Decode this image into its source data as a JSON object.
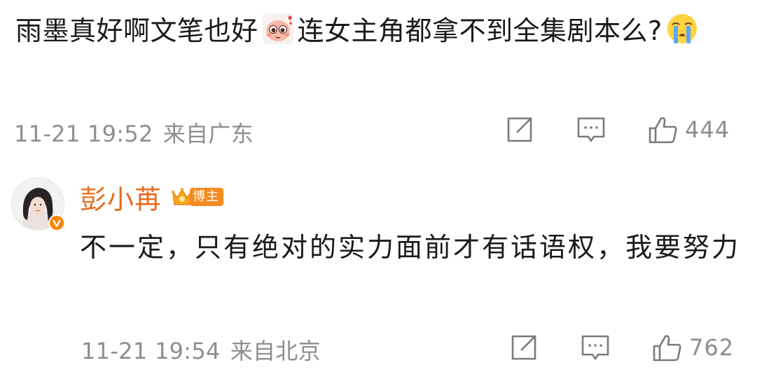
{
  "comment": {
    "text_part1": "雨墨真好啊文笔也好",
    "emoji1": "shy-blush-emoji",
    "text_part2": "连女主角都拿不到全集剧本么?",
    "emoji2": "crying-face-emoji",
    "date_time": "11-21 19:52",
    "location": "来自广东",
    "like_count": "444"
  },
  "reply": {
    "author": "彭小苒",
    "badge_label": "博主",
    "text": "不一定，只有绝对的实力面前才有话语权，我要努力",
    "date_time": "11-21 19:54",
    "location": "来自北京",
    "like_count": "762"
  },
  "colors": {
    "author_name": "#ea6a1e",
    "meta_text": "#8e8e8e",
    "body_text": "#1a1a1a",
    "badge_bg": "#f58a1f",
    "verified_badge": "#ff8200"
  },
  "icons": [
    "share-icon",
    "comment-icon",
    "like-icon",
    "verified-badge-icon",
    "crown-icon"
  ]
}
